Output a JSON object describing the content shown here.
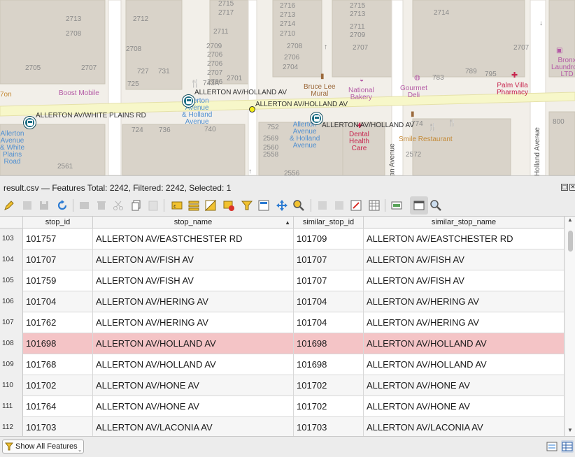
{
  "map": {
    "labels": {
      "stop_holland_1": "ALLERTON AV/HOLLAND AV",
      "stop_holland_2": "ALLERTON AV/HOLLAND AV",
      "stop_holland_3": "ALLERTON AV/HOLLAND AV",
      "stop_white_plains": "ALLERTON AV/WHITE PLAINS RD"
    },
    "house_numbers": [
      "2715",
      "2716",
      "2715",
      "2717",
      "2713",
      "2714",
      "2713",
      "2713",
      "2714",
      "2712",
      "2711",
      "2710",
      "2711",
      "2709",
      "2709",
      "2708",
      "2707",
      "2708",
      "2708",
      "2707",
      "2707",
      "2706",
      "2706",
      "2706",
      "2705",
      "2704",
      "2707",
      "2706",
      "727",
      "731",
      "725",
      "743A",
      "2701",
      "783",
      "789",
      "795",
      "724",
      "736",
      "740",
      "752",
      "774",
      "800",
      "2569",
      "2560",
      "2558",
      "2572",
      "2561",
      "2556"
    ],
    "pois": {
      "boost_mobile": "Boost Mobile",
      "bruce_lee": "Bruce Lee\nMural",
      "national_bakery": "National\nBakery",
      "gourmet_deli": "Gourmet\nDeli",
      "palm_villa": "Palm Villa\nPharmacy",
      "bronx_laundromat": "Bronx\nLaundrom\nLTD",
      "allerton_holland": "Allerton\nAvenue\n& Holland\nAvenue",
      "allerton_holland_2": "Allerton\nAvenue\n& Holland\nAvenue",
      "allerton_white_plains": "Allerton\nAvenue\n& White\nPlains\nRoad",
      "dental": "Dental\nHealth\nCare",
      "smile_restaurant": "Smile Restaurant",
      "bean_avenue": "Bean Avenue",
      "holland_avenue": "Holland Avenue",
      "left_edge": "7on"
    },
    "colors": {
      "road_main": "#f7f7c9",
      "road_minor": "#ffffff",
      "building": "#d9d3c9",
      "land": "#f2efe9",
      "bus": "#1d6f85",
      "poi_pink": "#b45aa5",
      "poi_brown": "#9c6a3c",
      "poi_red": "#c7254e",
      "poi_orange": "#c48a37",
      "poi_blue": "#4f8fd1"
    }
  },
  "window": {
    "title": "result.csv — Features Total: 2242, Filtered: 2242, Selected: 1",
    "float_icon": "float-icon",
    "close_icon": "close-icon"
  },
  "toolbar": {
    "buttons": [
      {
        "name": "toggle-editing-icon",
        "enabled": true
      },
      {
        "name": "multi-edit-icon",
        "enabled": false
      },
      {
        "name": "save-edits-icon",
        "enabled": false
      },
      {
        "name": "reload-icon",
        "enabled": true
      },
      {
        "name": "add-feature-icon",
        "enabled": false
      },
      {
        "name": "delete-feature-icon",
        "enabled": false
      },
      {
        "name": "cut-icon",
        "enabled": false
      },
      {
        "name": "copy-icon",
        "enabled": true
      },
      {
        "name": "paste-icon",
        "enabled": false
      },
      {
        "name": "select-expression-icon",
        "enabled": true
      },
      {
        "name": "select-all-icon",
        "enabled": true
      },
      {
        "name": "invert-selection-icon",
        "enabled": true
      },
      {
        "name": "deselect-all-icon",
        "enabled": true
      },
      {
        "name": "filter-select-icon",
        "enabled": true
      },
      {
        "name": "move-selection-top-icon",
        "enabled": true
      },
      {
        "name": "pan-to-selected-icon",
        "enabled": true
      },
      {
        "name": "zoom-to-selected-icon",
        "enabled": true
      },
      {
        "name": "new-field-icon",
        "enabled": false
      },
      {
        "name": "delete-field-icon",
        "enabled": false
      },
      {
        "name": "field-calculator-icon",
        "enabled": true
      },
      {
        "name": "conditional-format-icon",
        "enabled": true
      },
      {
        "name": "actions-icon",
        "enabled": true
      },
      {
        "name": "dock-table-icon",
        "enabled": true
      },
      {
        "name": "table-settings-icon",
        "enabled": true
      }
    ]
  },
  "table": {
    "headers": [
      "stop_id",
      "stop_name",
      "similar_stop_id",
      "similar_stop_name"
    ],
    "sort_indicator": "▲",
    "rows": [
      {
        "n": "103",
        "cells": [
          "101757",
          "ALLERTON AV/EASTCHESTER RD",
          "101709",
          "ALLERTON AV/EASTCHESTER RD"
        ]
      },
      {
        "n": "104",
        "cells": [
          "101707",
          "ALLERTON AV/FISH AV",
          "101707",
          "ALLERTON AV/FISH AV"
        ]
      },
      {
        "n": "105",
        "cells": [
          "101759",
          "ALLERTON AV/FISH AV",
          "101707",
          "ALLERTON AV/FISH AV"
        ]
      },
      {
        "n": "106",
        "cells": [
          "101704",
          "ALLERTON AV/HERING AV",
          "101704",
          "ALLERTON AV/HERING AV"
        ]
      },
      {
        "n": "107",
        "cells": [
          "101762",
          "ALLERTON AV/HERING AV",
          "101704",
          "ALLERTON AV/HERING AV"
        ]
      },
      {
        "n": "108",
        "cells": [
          "101698",
          "ALLERTON AV/HOLLAND AV",
          "101698",
          "ALLERTON AV/HOLLAND AV"
        ],
        "selected": true
      },
      {
        "n": "109",
        "cells": [
          "101768",
          "ALLERTON AV/HOLLAND AV",
          "101698",
          "ALLERTON AV/HOLLAND AV"
        ]
      },
      {
        "n": "110",
        "cells": [
          "101702",
          "ALLERTON AV/HONE AV",
          "101702",
          "ALLERTON AV/HONE AV"
        ]
      },
      {
        "n": "111",
        "cells": [
          "101764",
          "ALLERTON AV/HONE AV",
          "101702",
          "ALLERTON AV/HONE AV"
        ]
      },
      {
        "n": "112",
        "cells": [
          "101703",
          "ALLERTON AV/LACONIA AV",
          "101703",
          "ALLERTON AV/LACONIA AV"
        ]
      }
    ],
    "selected_color": "#f4c4c6"
  },
  "bottombar": {
    "show_all_label": "Show All Features",
    "dropdown_arrow": "⌄"
  }
}
